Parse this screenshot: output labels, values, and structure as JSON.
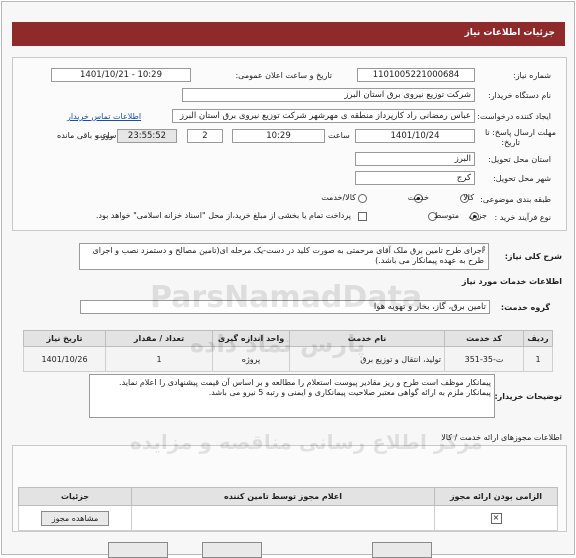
{
  "header": {
    "title": "جزئیات اطلاعات نیاز"
  },
  "fields": {
    "need_number_label": "شماره نیاز:",
    "need_number": "1101005221000684",
    "announce_label": "تاریخ و ساعت اعلان عمومی:",
    "announce_value": "1401/10/21 - 10:29",
    "buyer_label": "نام دستگاه خریدار:",
    "buyer_value": "شرکت توزیع نیروی برق استان البرز",
    "creator_label": "ایجاد کننده درخواست:",
    "creator_value": "عباس رمضانی راد کارپرداز منطقه ی مهرشهر شرکت توزیع نیروی برق استان البرز",
    "contact_link": "اطلاعات تماس خریدار",
    "deadline_label": "مهلت ارسال پاسخ: تا",
    "deadline_label2": "تاریخ:",
    "deadline_date": "1401/10/24",
    "time_label": "ساعت",
    "deadline_time": "10:29",
    "days_value": "2",
    "days_label": "روز و",
    "remaining_time": "23:55:52",
    "remaining_label": "ساعت باقی مانده",
    "province_label": "استان محل تحویل:",
    "province_value": "البرز",
    "city_label": "شهر محل تحویل:",
    "city_value": "کرج",
    "category_label": "طبقه بندی موضوعی:",
    "category_options": [
      "کالا",
      "خدمت",
      "کالا/خدمت"
    ],
    "process_label": "نوع فرآیند خرید :",
    "process_options": [
      "جزیی",
      "متوسط"
    ],
    "payment_note": "پرداخت تمام یا بخشی از مبلغ خرید،از محل \"اسناد خزانه اسلامی\" خواهد بود."
  },
  "need": {
    "label": "شرح کلی نیاز:",
    "text": "اجرای طرح تامین برق ملک آقای مرحمتی به صورت کلید در دست-یک مرحله ای(تامین مصالح و دستمزد نصب و اجرای طرح به عهده پیمانکار می باشد.)"
  },
  "services": {
    "section_title": "اطلاعات خدمات مورد نیاز",
    "group_label": "گروه خدمت:",
    "group_value": "تامین برق، گاز، بخار و تهویه هوا",
    "columns": [
      "ردیف",
      "کد خدمت",
      "نام خدمت",
      "واحد اندازه گیری",
      "تعداد / مقدار",
      "تاریخ نیاز"
    ],
    "rows": [
      {
        "row": "1",
        "code": "ت-35-351",
        "name": "تولید، انتقال و توزیع برق",
        "unit": "پروژه",
        "qty": "1",
        "date": "1401/10/26"
      }
    ]
  },
  "buyer_notes": {
    "label": "توضیحات خریدار:",
    "line1": "پیمانکار موظف است طرح و ریز مقادیر پیوست استعلام را مطالعه و بر اساس آن قیمت پیشنهادی را اعلام نماید.",
    "line2": "پیمانکار ملزم به ارائه گواهی معتبر صلاحیت پیمانکاری و ایمنی و رتبه 5 نیرو می باشد."
  },
  "licenses": {
    "section_title": "اطلاعات مجوزهای ارائه خدمت / کالا",
    "columns": [
      "الزامی بودن ارائه مجوز",
      "اعلام مجوز توسط تامین کننده",
      "جزئیات"
    ],
    "view_button": "مشاهده مجوز"
  },
  "watermark": {
    "text1": "ParsNamadData",
    "text2": "پارس نماد داده",
    "text3": "مرکز اطلاع رسانی مناقصه و مزایده"
  },
  "colors": {
    "title_bar": "#8e2a2a",
    "link": "#1a4fa0"
  }
}
